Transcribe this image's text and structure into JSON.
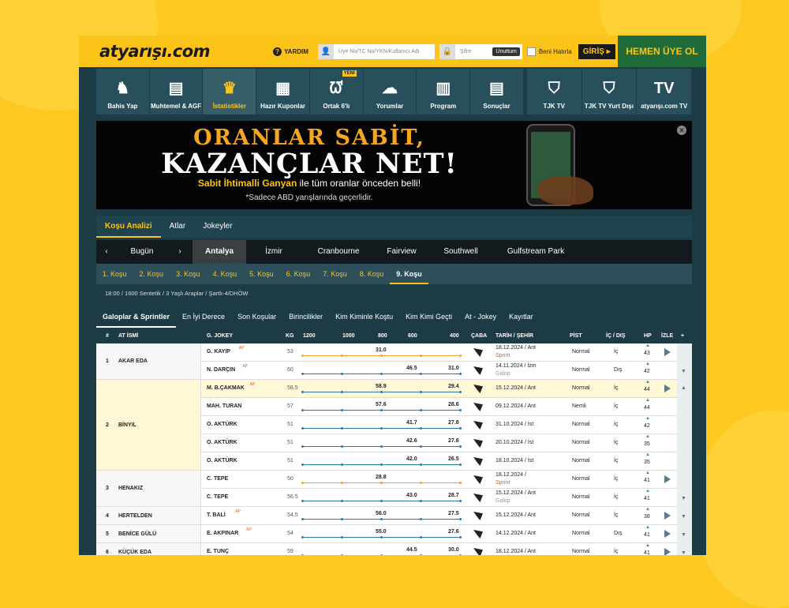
{
  "header": {
    "logo": "atyarışı.com",
    "help": "YARDIM",
    "user_placeholder": "Üye No/TC No/YKN/Kullanıcı Adı",
    "pass_placeholder": "Şifre",
    "forgot": "Unuttum",
    "remember": "Beni Hatırla",
    "login": "GİRİŞ ▸",
    "register": "HEMEN ÜYE OL"
  },
  "nav": [
    {
      "label": "Bahis Yap",
      "icon": "♞"
    },
    {
      "label": "Muhtemel & AGF",
      "icon": "▤"
    },
    {
      "label": "İstatistikler",
      "icon": "♛"
    },
    {
      "label": "Hazır Kuponlar",
      "icon": "▦"
    },
    {
      "label": "Ortak 6'lı",
      "icon": "ᘺ",
      "badge": "YENİ"
    },
    {
      "label": "Yorumlar",
      "icon": "☁"
    },
    {
      "label": "Program",
      "icon": "▥"
    },
    {
      "label": "Sonuçlar",
      "icon": "▤"
    },
    {
      "label": "TJK TV",
      "icon": "⛉"
    },
    {
      "label": "TJK TV Yurt Dışı",
      "icon": "⛉"
    },
    {
      "label": "atyarışı.com TV",
      "icon": "TV"
    }
  ],
  "banner": {
    "line1": "ORANLAR SABİT,",
    "line2": "KAZANÇLAR NET!",
    "line3a": "Sabit İhtimalli Ganyan",
    "line3b": " ile tüm oranlar önceden belli!",
    "line4": "*Sadece ABD yarışlarında geçerlidir."
  },
  "tabs1": [
    "Koşu Analizi",
    "Atlar",
    "Jokeyler"
  ],
  "tabs2": {
    "prev": "‹",
    "day": "Bugün",
    "next": "›",
    "cities": [
      "Antalya",
      "İzmir",
      "Cranbourne",
      "Fairview",
      "Southwell",
      "Gulfstream Park"
    ]
  },
  "tabs3": [
    "1. Koşu",
    "2. Koşu",
    "3. Koşu",
    "4. Koşu",
    "5. Koşu",
    "6. Koşu",
    "7. Koşu",
    "8. Koşu",
    "9. Koşu"
  ],
  "race_info": "18:00 / 1600 Sentetik / 3 Yaşlı Araplar / Şartlı-4/DHÖW",
  "tabs4": [
    "Galoplar & Sprintler",
    "En İyi Derece",
    "Son Koşular",
    "Birincilikler",
    "Kim Kiminle Koştu",
    "Kim Kimi Geçti",
    "At - Jokey",
    "Kayıtlar"
  ],
  "table": {
    "headers": {
      "no": "#",
      "horse": "AT İSMİ",
      "jockey": "G. JOKEY",
      "kg": "KG",
      "d1200": "1200",
      "d1000": "1000",
      "d800": "800",
      "d600": "600",
      "d400": "400",
      "caba": "ÇABA",
      "date": "TARİH / ŞEHİR",
      "track": "PİST",
      "inout": "İÇ / DIŞ",
      "hp": "HP",
      "watch": "İZLE",
      "plus": "+"
    },
    "rows": [
      {
        "no": "1",
        "horse": "AKAR EDA",
        "jockey": "G. KAYIP",
        "ap": "AP",
        "kg": "53",
        "v800": "31.0",
        "v400": "",
        "date": "18.12.2024 / Ant",
        "sub": "Sprint",
        "track": "Normal",
        "io": "İç",
        "hp": "43"
      },
      {
        "no": "",
        "horse": "",
        "jockey": "N. DARÇIN",
        "ap": "AP",
        "kg": "60",
        "v800": "",
        "v600": "46.5",
        "v400": "31.0",
        "date": "14.11.2024 / İzm",
        "sub": "Galop",
        "track": "Normal",
        "io": "Dış",
        "hp": "42"
      },
      {
        "no": "2",
        "horse": "BİNYIL",
        "jockey": "M. B.ÇAKMAK",
        "ap": "AP",
        "kg": "58.5",
        "v800": "58.9",
        "v400": "29.4",
        "date": "15.12.2024 / Ant",
        "sub": "",
        "track": "Normal",
        "io": "İç",
        "hp": "44"
      },
      {
        "no": "",
        "horse": "",
        "jockey": "MAH. TURAN",
        "ap": "",
        "kg": "57",
        "v800": "57.6",
        "v400": "28.6",
        "date": "09.12.2024 / Ant",
        "sub": "",
        "track": "Nemli",
        "io": "İç",
        "hp": "44"
      },
      {
        "no": "",
        "horse": "",
        "jockey": "O. AKTÜRK",
        "ap": "",
        "kg": "51",
        "v600": "41.7",
        "v400": "27.8",
        "date": "31.10.2024 / İst",
        "sub": "",
        "track": "Normal",
        "io": "İç",
        "hp": "42"
      },
      {
        "no": "",
        "horse": "",
        "jockey": "O. AKTÜRK",
        "ap": "",
        "kg": "51",
        "v600": "42.6",
        "v400": "27.8",
        "date": "20.10.2024 / İst",
        "sub": "",
        "track": "Normal",
        "io": "İç",
        "hp": "35"
      },
      {
        "no": "",
        "horse": "",
        "jockey": "O. AKTÜRK",
        "ap": "",
        "kg": "51",
        "v600": "42.0",
        "v400": "26.5",
        "date": "18.10.2024 / İst",
        "sub": "",
        "track": "Normal",
        "io": "İç",
        "hp": "35"
      },
      {
        "no": "3",
        "horse": "HENAKIZ",
        "jockey": "C. TEPE",
        "ap": "",
        "kg": "50",
        "v800": "28.8",
        "v400": "",
        "date": "18.12.2024 /",
        "sub": "Sprint",
        "track": "Normal",
        "io": "İç",
        "hp": "41"
      },
      {
        "no": "",
        "horse": "",
        "jockey": "C. TEPE",
        "ap": "",
        "kg": "56.5",
        "v600": "43.0",
        "v400": "28.7",
        "date": "15.12.2024 / Ant",
        "sub": "Galop",
        "track": "Normal",
        "io": "İç",
        "hp": "41"
      },
      {
        "no": "4",
        "horse": "HERTELDEN",
        "jockey": "T. BALİ",
        "ap": "AP",
        "kg": "54.5",
        "v800": "56.0",
        "v400": "27.5",
        "date": "15.12.2024 / Ant",
        "sub": "",
        "track": "Normal",
        "io": "İç",
        "hp": "38"
      },
      {
        "no": "5",
        "horse": "BENİCE GÜLÜ",
        "jockey": "E. AKPINAR",
        "ap": "AP",
        "kg": "54",
        "v800": "55.0",
        "v400": "27.6",
        "date": "14.12.2024 / Ant",
        "sub": "",
        "track": "Normal",
        "io": "Dış",
        "hp": "41"
      },
      {
        "no": "6",
        "horse": "KÜÇÜK EDA",
        "jockey": "E. TUNÇ",
        "ap": "",
        "kg": "59",
        "v600": "44.5",
        "v400": "30.0",
        "date": "18.12.2024 / Ant",
        "sub": "",
        "track": "Normal",
        "io": "İç",
        "hp": "41"
      }
    ]
  }
}
